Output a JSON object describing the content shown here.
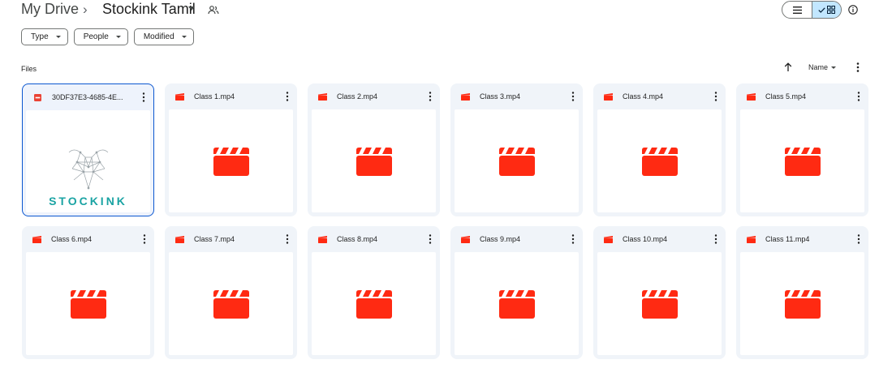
{
  "breadcrumb": {
    "root": "My Drive",
    "separator": "›",
    "folder": "Stockink Tamil"
  },
  "filters": [
    {
      "label": "Type"
    },
    {
      "label": "People"
    },
    {
      "label": "Modified"
    }
  ],
  "section": {
    "label": "Files",
    "sort_label": "Name"
  },
  "colors": {
    "video_red": "#ff2a12",
    "selected_border": "#0b57d0",
    "card_bg": "#f0f4f9",
    "toggle_active": "#c2e7ff",
    "logo_teal": "#1aa3a3"
  },
  "files": [
    {
      "name": "30DF37E3-4685-4E...",
      "type": "pdf",
      "icon": "pdf-icon",
      "selected": true,
      "thumb_text": "STOCKINK"
    },
    {
      "name": "Class 1.mp4",
      "type": "video",
      "icon": "video-icon"
    },
    {
      "name": "Class 2.mp4",
      "type": "video",
      "icon": "video-icon"
    },
    {
      "name": "Class 3.mp4",
      "type": "video",
      "icon": "video-icon"
    },
    {
      "name": "Class 4.mp4",
      "type": "video",
      "icon": "video-icon"
    },
    {
      "name": "Class 5.mp4",
      "type": "video",
      "icon": "video-icon"
    },
    {
      "name": "Class 6.mp4",
      "type": "video",
      "icon": "video-icon"
    },
    {
      "name": "Class 7.mp4",
      "type": "video",
      "icon": "video-icon"
    },
    {
      "name": "Class 8.mp4",
      "type": "video",
      "icon": "video-icon"
    },
    {
      "name": "Class 9.mp4",
      "type": "video",
      "icon": "video-icon"
    },
    {
      "name": "Class 10.mp4",
      "type": "video",
      "icon": "video-icon"
    },
    {
      "name": "Class 11.mp4",
      "type": "video",
      "icon": "video-icon"
    }
  ]
}
